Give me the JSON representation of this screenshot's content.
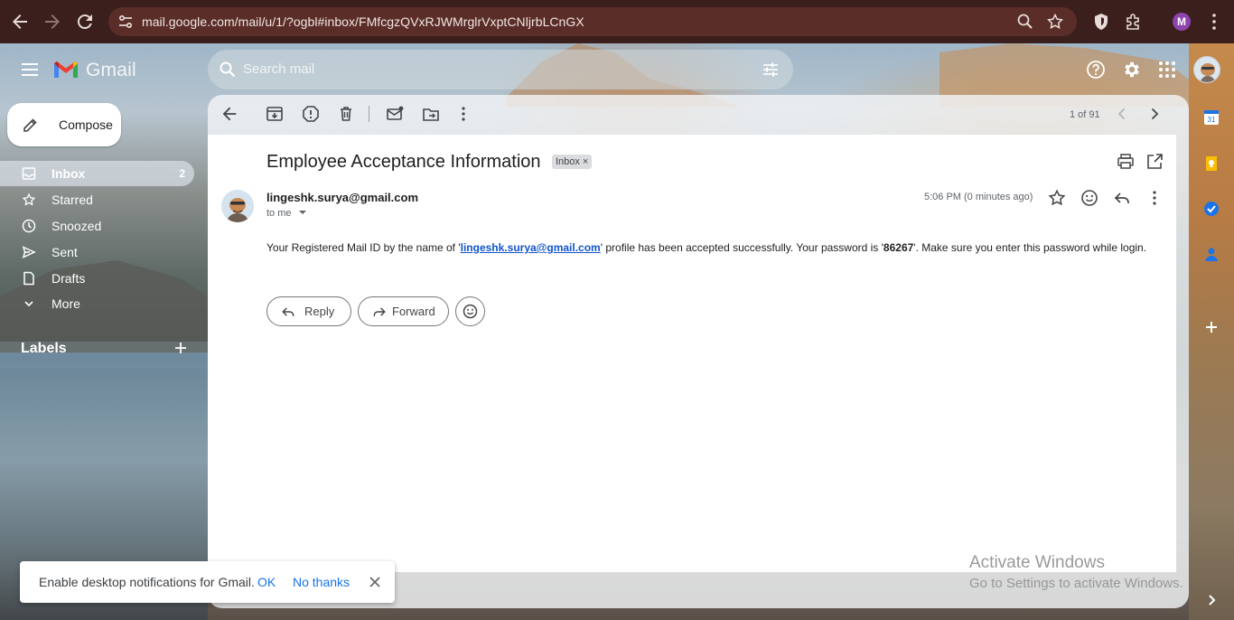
{
  "browser": {
    "url": "mail.google.com/mail/u/1/?ogbl#inbox/FMfcgzQVxRJWMrglrVxptCNljrbLCnGX",
    "profile_initial": "M"
  },
  "header": {
    "app_name": "Gmail",
    "search_placeholder": "Search mail"
  },
  "sidebar": {
    "compose_label": "Compose",
    "items": [
      {
        "label": "Inbox",
        "count": "2",
        "icon": "inbox-icon",
        "active": true
      },
      {
        "label": "Starred",
        "icon": "star-icon"
      },
      {
        "label": "Snoozed",
        "icon": "clock-icon"
      },
      {
        "label": "Sent",
        "icon": "send-icon"
      },
      {
        "label": "Drafts",
        "icon": "draft-icon"
      },
      {
        "label": "More",
        "icon": "chevron-down-icon"
      }
    ],
    "labels_title": "Labels"
  },
  "toolbar": {
    "page_count": "1 of 91"
  },
  "email": {
    "subject": "Employee Acceptance Information",
    "chip": "Inbox",
    "sender": "lingeshk.surya@gmail.com",
    "to": "to me",
    "time": "5:06 PM (0 minutes ago)",
    "body_prefix": "Your Registered Mail ID by the name of '",
    "body_link": "lingeshk.surya@gmail.com",
    "body_middle": "' profile has been accepted successfully. Your password is '",
    "body_password": "86267",
    "body_suffix": "'. Make sure you enter this password while login."
  },
  "actions": {
    "reply": "Reply",
    "forward": "Forward"
  },
  "toast": {
    "message": "Enable desktop notifications for Gmail.",
    "ok": "OK",
    "no_thanks": "No thanks"
  },
  "watermark": {
    "line1": "Activate Windows",
    "line2": "Go to Settings to activate Windows."
  },
  "colors": {
    "chrome": "#3a1f1c",
    "link": "#1155cc",
    "accent_blue": "#1a73e8"
  }
}
